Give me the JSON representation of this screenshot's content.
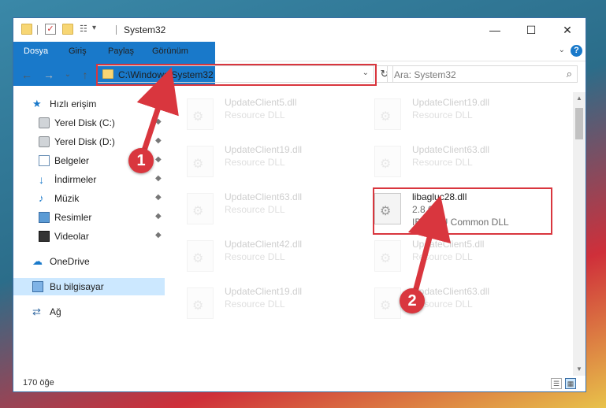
{
  "window": {
    "title": "System32",
    "controls": {
      "minimize": "—",
      "maximize": "☐",
      "close": "✕"
    }
  },
  "ribbon": {
    "tabs": [
      "Dosya",
      "Giriş",
      "Paylaş",
      "Görünüm"
    ],
    "help": "?",
    "collapse": "⌄"
  },
  "nav": {
    "back": "←",
    "forward": "→",
    "recent": "⌄",
    "up": "↑",
    "address": "C:\\Windows\\System32",
    "refresh": "↻",
    "search_placeholder": "Ara: System32",
    "search_icon": "⌕"
  },
  "sidebar": {
    "quick_access": "Hızlı erişim",
    "items": [
      {
        "label": "Yerel Disk (C:)",
        "icon": "drive-icon"
      },
      {
        "label": "Yerel Disk (D:)",
        "icon": "drive-icon"
      },
      {
        "label": "Belgeler",
        "icon": "documents-icon"
      },
      {
        "label": "İndirmeler",
        "icon": "downloads-icon"
      },
      {
        "label": "Müzik",
        "icon": "music-icon"
      },
      {
        "label": "Resimler",
        "icon": "pictures-icon"
      },
      {
        "label": "Videolar",
        "icon": "videos-icon"
      }
    ],
    "pin": "📌",
    "onedrive": "OneDrive",
    "this_pc": "Bu bilgisayar",
    "network": "Ağ"
  },
  "files": {
    "left": [
      {
        "name": "UpdateClient5.dll",
        "desc": "Resource DLL"
      },
      {
        "name": "UpdateClient19.dll",
        "desc": "Resource DLL"
      },
      {
        "name": "UpdateClient63.dll",
        "desc": "Resource DLL"
      },
      {
        "name": "UpdateClient42.dll",
        "desc": "Resource DLL"
      },
      {
        "name": "UpdateClient19.dll",
        "desc": "Resource DLL"
      }
    ],
    "right": [
      {
        "name": "UpdateClient19.dll",
        "desc": "Resource DLL"
      },
      {
        "name": "UpdateClient63.dll",
        "desc": "Resource DLL"
      },
      {
        "name": "libagluc28.dll",
        "version": "2.8.0.0",
        "desc": "IBM ICU Common DLL"
      },
      {
        "name": "UpdateClient5.dll",
        "desc": "Resource DLL"
      },
      {
        "name": "UpdateClient63.dll",
        "desc": "Resource DLL"
      }
    ]
  },
  "status": {
    "count": "170 öğe"
  },
  "annotations": {
    "badge1": "1",
    "badge2": "2",
    "color": "#d9363e"
  }
}
